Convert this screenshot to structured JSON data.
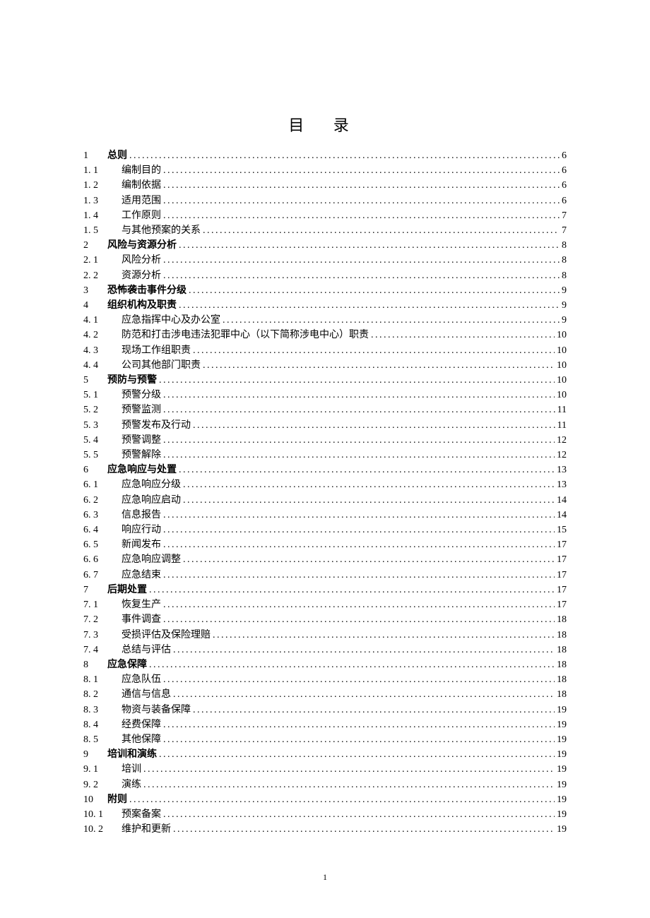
{
  "title": "目 录",
  "page_number": "1",
  "entries": [
    {
      "num": "1",
      "label": "总则",
      "page": "6",
      "level": 0,
      "bold": true
    },
    {
      "num": "1.1",
      "label": "编制目的",
      "page": "6",
      "level": 1,
      "bold": false
    },
    {
      "num": "1.2",
      "label": "编制依据",
      "page": "6",
      "level": 1,
      "bold": false
    },
    {
      "num": "1.3",
      "label": "适用范围",
      "page": "6",
      "level": 1,
      "bold": false
    },
    {
      "num": "1.4",
      "label": "工作原则",
      "page": "7",
      "level": 1,
      "bold": false
    },
    {
      "num": "1.5",
      "label": "与其他预案的关系",
      "page": "7",
      "level": 1,
      "bold": false
    },
    {
      "num": "2",
      "label": "风险与资源分析",
      "page": "8",
      "level": 0,
      "bold": true
    },
    {
      "num": "2.1",
      "label": "风险分析",
      "page": "8",
      "level": 1,
      "bold": false
    },
    {
      "num": "2.2",
      "label": "资源分析",
      "page": "8",
      "level": 1,
      "bold": false
    },
    {
      "num": "3",
      "label": "恐怖袭击事件分级",
      "page": "9",
      "level": 0,
      "bold": true
    },
    {
      "num": "4",
      "label": "组织机构及职责",
      "page": "9",
      "level": 0,
      "bold": true
    },
    {
      "num": "4.1",
      "label": "应急指挥中心及办公室",
      "page": "9",
      "level": 1,
      "bold": false
    },
    {
      "num": "4.2",
      "label": "防范和打击涉电违法犯罪中心（以下简称涉电中心）职责",
      "page": "10",
      "level": 1,
      "bold": false
    },
    {
      "num": "4.3",
      "label": "现场工作组职责",
      "page": "10",
      "level": 1,
      "bold": false
    },
    {
      "num": "4.4",
      "label": "公司其他部门职责",
      "page": "10",
      "level": 1,
      "bold": false
    },
    {
      "num": "5",
      "label": "预防与预警",
      "page": "10",
      "level": 0,
      "bold": true
    },
    {
      "num": "5.1",
      "label": "预警分级",
      "page": "10",
      "level": 1,
      "bold": false
    },
    {
      "num": "5.2",
      "label": "预警监测",
      "page": "11",
      "level": 1,
      "bold": false
    },
    {
      "num": "5.3",
      "label": "预警发布及行动",
      "page": "11",
      "level": 1,
      "bold": false
    },
    {
      "num": "5.4",
      "label": "预警调整",
      "page": "12",
      "level": 1,
      "bold": false
    },
    {
      "num": "5.5",
      "label": "预警解除",
      "page": "12",
      "level": 1,
      "bold": false
    },
    {
      "num": "6",
      "label": "应急响应与处置",
      "page": "13",
      "level": 0,
      "bold": true
    },
    {
      "num": "6.1",
      "label": "应急响应分级",
      "page": "13",
      "level": 1,
      "bold": false
    },
    {
      "num": "6.2",
      "label": "应急响应启动",
      "page": "14",
      "level": 1,
      "bold": false
    },
    {
      "num": "6.3",
      "label": "信息报告",
      "page": "14",
      "level": 1,
      "bold": false
    },
    {
      "num": "6.4",
      "label": "响应行动",
      "page": "15",
      "level": 1,
      "bold": false
    },
    {
      "num": "6.5",
      "label": "新闻发布",
      "page": "17",
      "level": 1,
      "bold": false
    },
    {
      "num": "6.6",
      "label": "应急响应调整",
      "page": "17",
      "level": 1,
      "bold": false
    },
    {
      "num": "6.7",
      "label": "应急结束",
      "page": "17",
      "level": 1,
      "bold": false
    },
    {
      "num": "7",
      "label": "后期处置",
      "page": "17",
      "level": 0,
      "bold": true
    },
    {
      "num": "7.1",
      "label": "恢复生产",
      "page": "17",
      "level": 1,
      "bold": false
    },
    {
      "num": "7.2",
      "label": "事件调查",
      "page": "18",
      "level": 1,
      "bold": false
    },
    {
      "num": "7.3",
      "label": "受损评估及保险理赔",
      "page": "18",
      "level": 1,
      "bold": false
    },
    {
      "num": "7.4",
      "label": "总结与评估",
      "page": "18",
      "level": 1,
      "bold": false
    },
    {
      "num": "8",
      "label": "应急保障",
      "page": "18",
      "level": 0,
      "bold": true
    },
    {
      "num": "8.1",
      "label": "应急队伍",
      "page": "18",
      "level": 1,
      "bold": false
    },
    {
      "num": "8.2",
      "label": "通信与信息",
      "page": "18",
      "level": 1,
      "bold": false
    },
    {
      "num": "8.3",
      "label": "物资与装备保障",
      "page": "19",
      "level": 1,
      "bold": false
    },
    {
      "num": "8.4",
      "label": "经费保障",
      "page": "19",
      "level": 1,
      "bold": false
    },
    {
      "num": "8.5",
      "label": "其他保障",
      "page": "19",
      "level": 1,
      "bold": false
    },
    {
      "num": "9",
      "label": "培训和演练",
      "page": "19",
      "level": 0,
      "bold": true
    },
    {
      "num": "9.1",
      "label": "培训",
      "page": "19",
      "level": 1,
      "bold": false
    },
    {
      "num": "9.2",
      "label": "演练",
      "page": "19",
      "level": 1,
      "bold": false
    },
    {
      "num": "10",
      "label": "附则",
      "page": "19",
      "level": 0,
      "bold": true
    },
    {
      "num": "10.1",
      "label": "预案备案",
      "page": "19",
      "level": 1,
      "bold": false
    },
    {
      "num": "10.2",
      "label": "维护和更新",
      "page": "19",
      "level": 1,
      "bold": false
    }
  ]
}
